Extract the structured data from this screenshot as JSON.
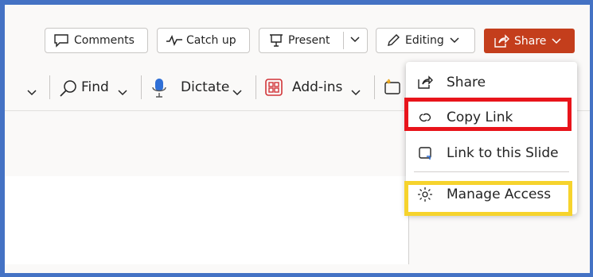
{
  "toolbar": {
    "comments_label": "Comments",
    "catchup_label": "Catch up",
    "present_label": "Present",
    "editing_label": "Editing",
    "share_label": "Share"
  },
  "ribbon": {
    "find_label": "Find",
    "dictate_label": "Dictate",
    "addins_label": "Add-ins"
  },
  "share_menu": {
    "items": [
      {
        "label": "Share",
        "icon": "share-icon"
      },
      {
        "label": "Copy Link",
        "icon": "link-icon"
      },
      {
        "label": "Link to this Slide",
        "icon": "slide-link-icon"
      },
      {
        "label": "Manage Access",
        "icon": "gear-icon"
      }
    ]
  },
  "colors": {
    "frame_border": "#4472c4",
    "share_button": "#c43e1c",
    "highlight_red": "#e8141b",
    "highlight_yellow": "#f6d32d"
  }
}
